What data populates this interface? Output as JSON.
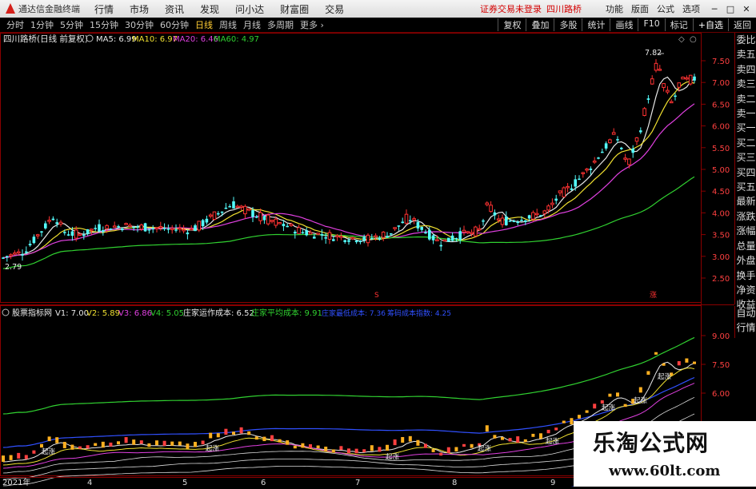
{
  "menubar": {
    "app_name": "通达信金融终端",
    "menus": [
      "行情",
      "市场",
      "资讯",
      "发现",
      "问小达",
      "财富圈",
      "交易"
    ],
    "notice": "证券交易未登录",
    "stock_name": "四川路桥",
    "right_menus": [
      "功能",
      "版面",
      "公式",
      "选项"
    ],
    "window_buttons": [
      "─",
      "□",
      "✕"
    ]
  },
  "toolbar": {
    "periods": [
      "分时",
      "1分钟",
      "5分钟",
      "15分钟",
      "30分钟",
      "60分钟",
      "日线",
      "周线",
      "月线",
      "多周期",
      "更多 ›"
    ],
    "active_period": "日线",
    "right_tools": [
      "复权",
      "叠加",
      "多股",
      "统计",
      "画线",
      "F10",
      "标记",
      "+自选",
      "返回"
    ]
  },
  "price_panel": {
    "title": "四川路桥(日线 前复权)",
    "ma_legend": [
      {
        "label": "MA5: 6.99",
        "color": "#e8e8e8"
      },
      {
        "label": "MA10: 6.97",
        "color": "#f0e030"
      },
      {
        "label": "MA20: 6.46",
        "color": "#e040e0"
      },
      {
        "label": "MA60: 4.97",
        "color": "#30d030"
      }
    ],
    "axis_ticks": [
      "7.50",
      "7.00",
      "6.50",
      "6.00",
      "5.50",
      "5.00",
      "4.50",
      "4.00",
      "3.50",
      "3.00",
      "2.50"
    ],
    "high_label": "7.82",
    "low_label": "2.79",
    "event_marks": [
      "S",
      "涨"
    ]
  },
  "indicator_panel": {
    "title": "股票指标网",
    "values": [
      {
        "label": "V1: 7.00",
        "color": "#e8e8e8"
      },
      {
        "label": "V2: 5.89",
        "color": "#f0e030"
      },
      {
        "label": "V3: 6.86",
        "color": "#e040e0"
      },
      {
        "label": "V4: 5.05",
        "color": "#30d030"
      },
      {
        "label": "庄家运作成本: 6.52",
        "color": "#e8e8e8"
      },
      {
        "label": "庄家平均成本: 9.91",
        "color": "#30d030"
      },
      {
        "label": "庄家最低成本: 7.36",
        "color": "#3050ff"
      },
      {
        "label": "筹码成本指数: 4.25",
        "color": "#3050ff"
      }
    ],
    "axis_ticks": [
      "9.00",
      "7.50",
      "6.00"
    ],
    "signal_labels": [
      "起涨",
      "起涨",
      "起涨",
      "起涨",
      "起涨",
      "起涨",
      "起涨",
      "起涨"
    ]
  },
  "side_panel": {
    "items": [
      "委比",
      "卖五",
      "卖四",
      "卖三",
      "卖二",
      "卖一",
      "买一",
      "买二",
      "买三",
      "买四",
      "买五",
      "最新",
      "涨跌",
      "涨幅",
      "总量",
      "外盘",
      "换手",
      "净资",
      "收益"
    ],
    "items2": [
      "自动",
      "行情"
    ]
  },
  "date_axis": [
    "2021年",
    "4",
    "5",
    "6",
    "7",
    "8",
    "9"
  ],
  "watermark": {
    "line1": "乐淘公式网",
    "line2": "www.60lt.com"
  },
  "colors": {
    "up": "#ff3232",
    "down": "#54fcfc",
    "frame": "#8a0000",
    "ma5": "#e8e8e8",
    "ma10": "#f0e030",
    "ma20": "#e040e0",
    "ma60": "#30d030"
  }
}
